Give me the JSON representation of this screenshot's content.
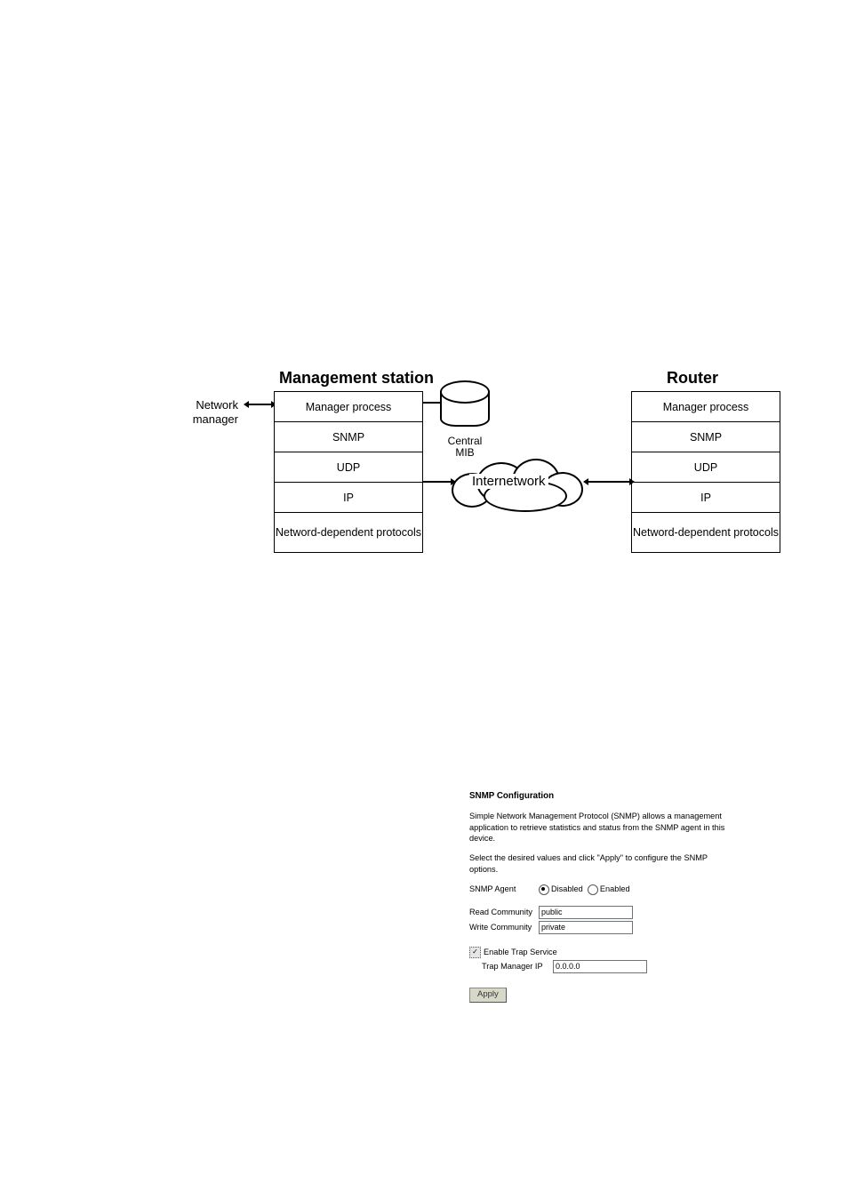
{
  "diagram": {
    "heading_mgmt": "Management station",
    "heading_router": "Router",
    "side_label_line1": "Network",
    "side_label_line2": "manager",
    "mib_label_line1": "Central",
    "mib_label_line2": "MIB",
    "cloud_label": "Internetwork",
    "left_stack": [
      "Manager process",
      "SNMP",
      "UDP",
      "IP",
      "Netword-dependent protocols"
    ],
    "right_stack": [
      "Manager process",
      "SNMP",
      "UDP",
      "IP",
      "Netword-dependent protocols"
    ]
  },
  "form": {
    "title": "SNMP Configuration",
    "intro": "Simple Network Management Protocol (SNMP) allows a management application to retrieve statistics and status from the SNMP agent in this device.",
    "instruction": "Select the desired values and click \"Apply\" to configure the SNMP options.",
    "agent_label": "SNMP Agent",
    "disabled_label": "Disabled",
    "enabled_label": "Enabled",
    "read_community_label": "Read Community",
    "read_community_value": "public",
    "write_community_label": "Write Community",
    "write_community_value": "private",
    "enable_trap_label": "Enable Trap Service",
    "trap_manager_ip_label": "Trap Manager IP",
    "trap_manager_ip_value": "0.0.0.0",
    "apply_label": "Apply"
  }
}
